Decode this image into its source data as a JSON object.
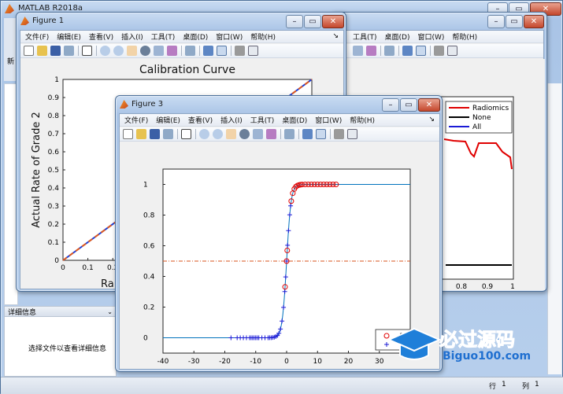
{
  "main_window": {
    "title": "MATLAB R2018a"
  },
  "left_panel": {
    "details_header": "详细信息",
    "details_empty": "选择文件以查看详细信息",
    "cut_label": "新"
  },
  "status_bar": {
    "row_label": "行",
    "row_value": "1",
    "col_label": "列",
    "col_value": "1"
  },
  "menus": [
    "文件(F)",
    "编辑(E)",
    "查看(V)",
    "插入(I)",
    "工具(T)",
    "桌面(D)",
    "窗口(W)",
    "帮助(H)"
  ],
  "figure_back": {
    "menus": [
      "工具(T)",
      "桌面(D)",
      "窗口(W)",
      "帮助(H)"
    ],
    "legend": [
      "Radiomics",
      "None",
      "All"
    ],
    "x_ticks": [
      "0.8",
      "0.9",
      "1"
    ]
  },
  "figure1": {
    "title": "Figure 1",
    "chart_data": {
      "type": "line",
      "title": "Calibration Curve",
      "ylabel": "Actual Rate of Grade 2",
      "xlabel": "Ra",
      "xlim": [
        0,
        1
      ],
      "ylim": [
        0,
        1
      ],
      "y_ticks": [
        "0",
        "0.1",
        "0.2",
        "0.3",
        "0.4",
        "0.5",
        "0.6",
        "0.7",
        "0.8",
        "0.9",
        "1"
      ],
      "x_ticks": [
        "0",
        "0.1",
        "0.2"
      ],
      "series": [
        {
          "style": "solid",
          "color": "#1f3fd6",
          "x": [
            0,
            1
          ],
          "y": [
            0,
            1
          ]
        },
        {
          "style": "dashed",
          "color": "#e05a1e",
          "x": [
            0,
            1
          ],
          "y": [
            0,
            1
          ]
        }
      ]
    }
  },
  "figure3": {
    "title": "Figure 3",
    "chart_data": {
      "type": "scatter",
      "xlim": [
        -40,
        40
      ],
      "ylim": [
        -0.1,
        1.1
      ],
      "x_ticks": [
        "-40",
        "-30",
        "-20",
        "-10",
        "0",
        "10",
        "20",
        "30"
      ],
      "y_ticks": [
        "0",
        "0.2",
        "0.4",
        "0.6",
        "0.8",
        "1"
      ],
      "threshold_y": 0.5,
      "legend": [
        "1"
      ],
      "sigmoid_center": 0,
      "sigmoid_slope": 1.4,
      "curve_x_range": [
        -40,
        40
      ],
      "red_circles_x": [
        -0.5,
        0,
        0.2,
        1.5,
        2,
        2.5,
        3,
        3.5,
        4,
        4.5,
        5,
        6,
        7,
        8,
        9,
        10,
        11,
        12,
        13,
        14,
        15,
        16
      ],
      "blue_plus_x": [
        -18,
        -16,
        -15,
        -14,
        -13,
        -12,
        -11.5,
        -11,
        -10.5,
        -10,
        -9.5,
        -9,
        -8,
        -7,
        -6,
        -5.5,
        -5,
        -4.5,
        -4,
        -3.5,
        -3,
        -2.5,
        -2,
        -1.5,
        -1,
        -0.6,
        -0.3,
        0,
        0.3,
        0.6,
        1,
        1.3
      ]
    }
  },
  "watermark": {
    "text_cn": "必过源码",
    "text_en": "Biguo100.com"
  }
}
